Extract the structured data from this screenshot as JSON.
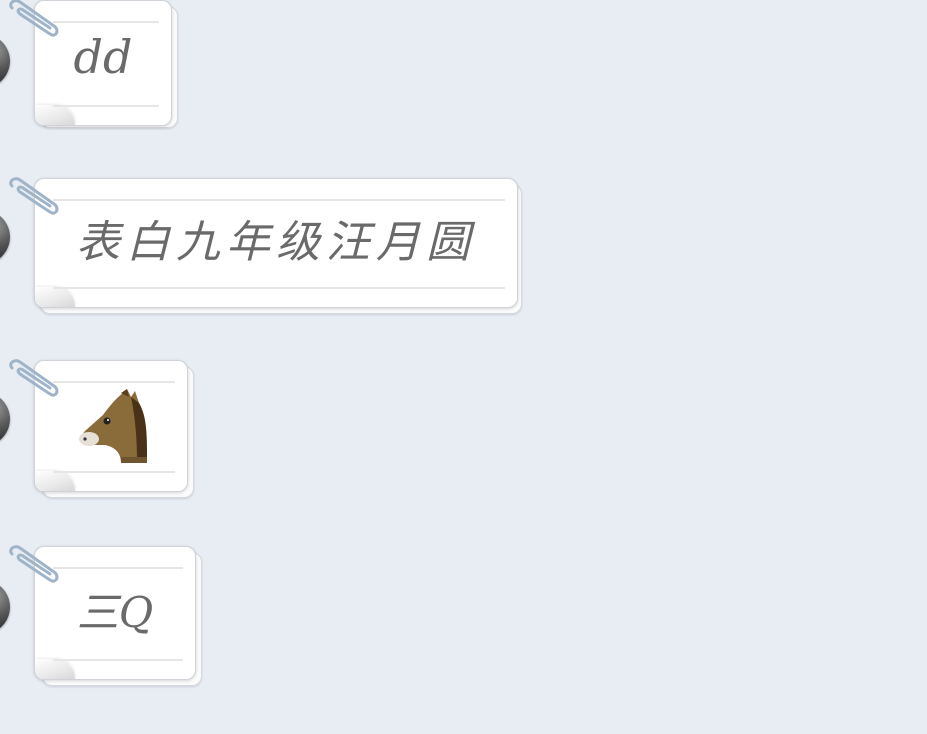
{
  "messages": [
    {
      "text": "dd",
      "type": "text"
    },
    {
      "text": "表白九年级汪月圆",
      "type": "text"
    },
    {
      "text": "",
      "type": "emoji",
      "icon": "horse-emoji"
    },
    {
      "text": "三Q",
      "type": "text"
    }
  ],
  "colors": {
    "background": "#e8ecf3",
    "bubble": "#ffffff",
    "text": "#6a6a6a",
    "clip": "#9fb4c8"
  }
}
